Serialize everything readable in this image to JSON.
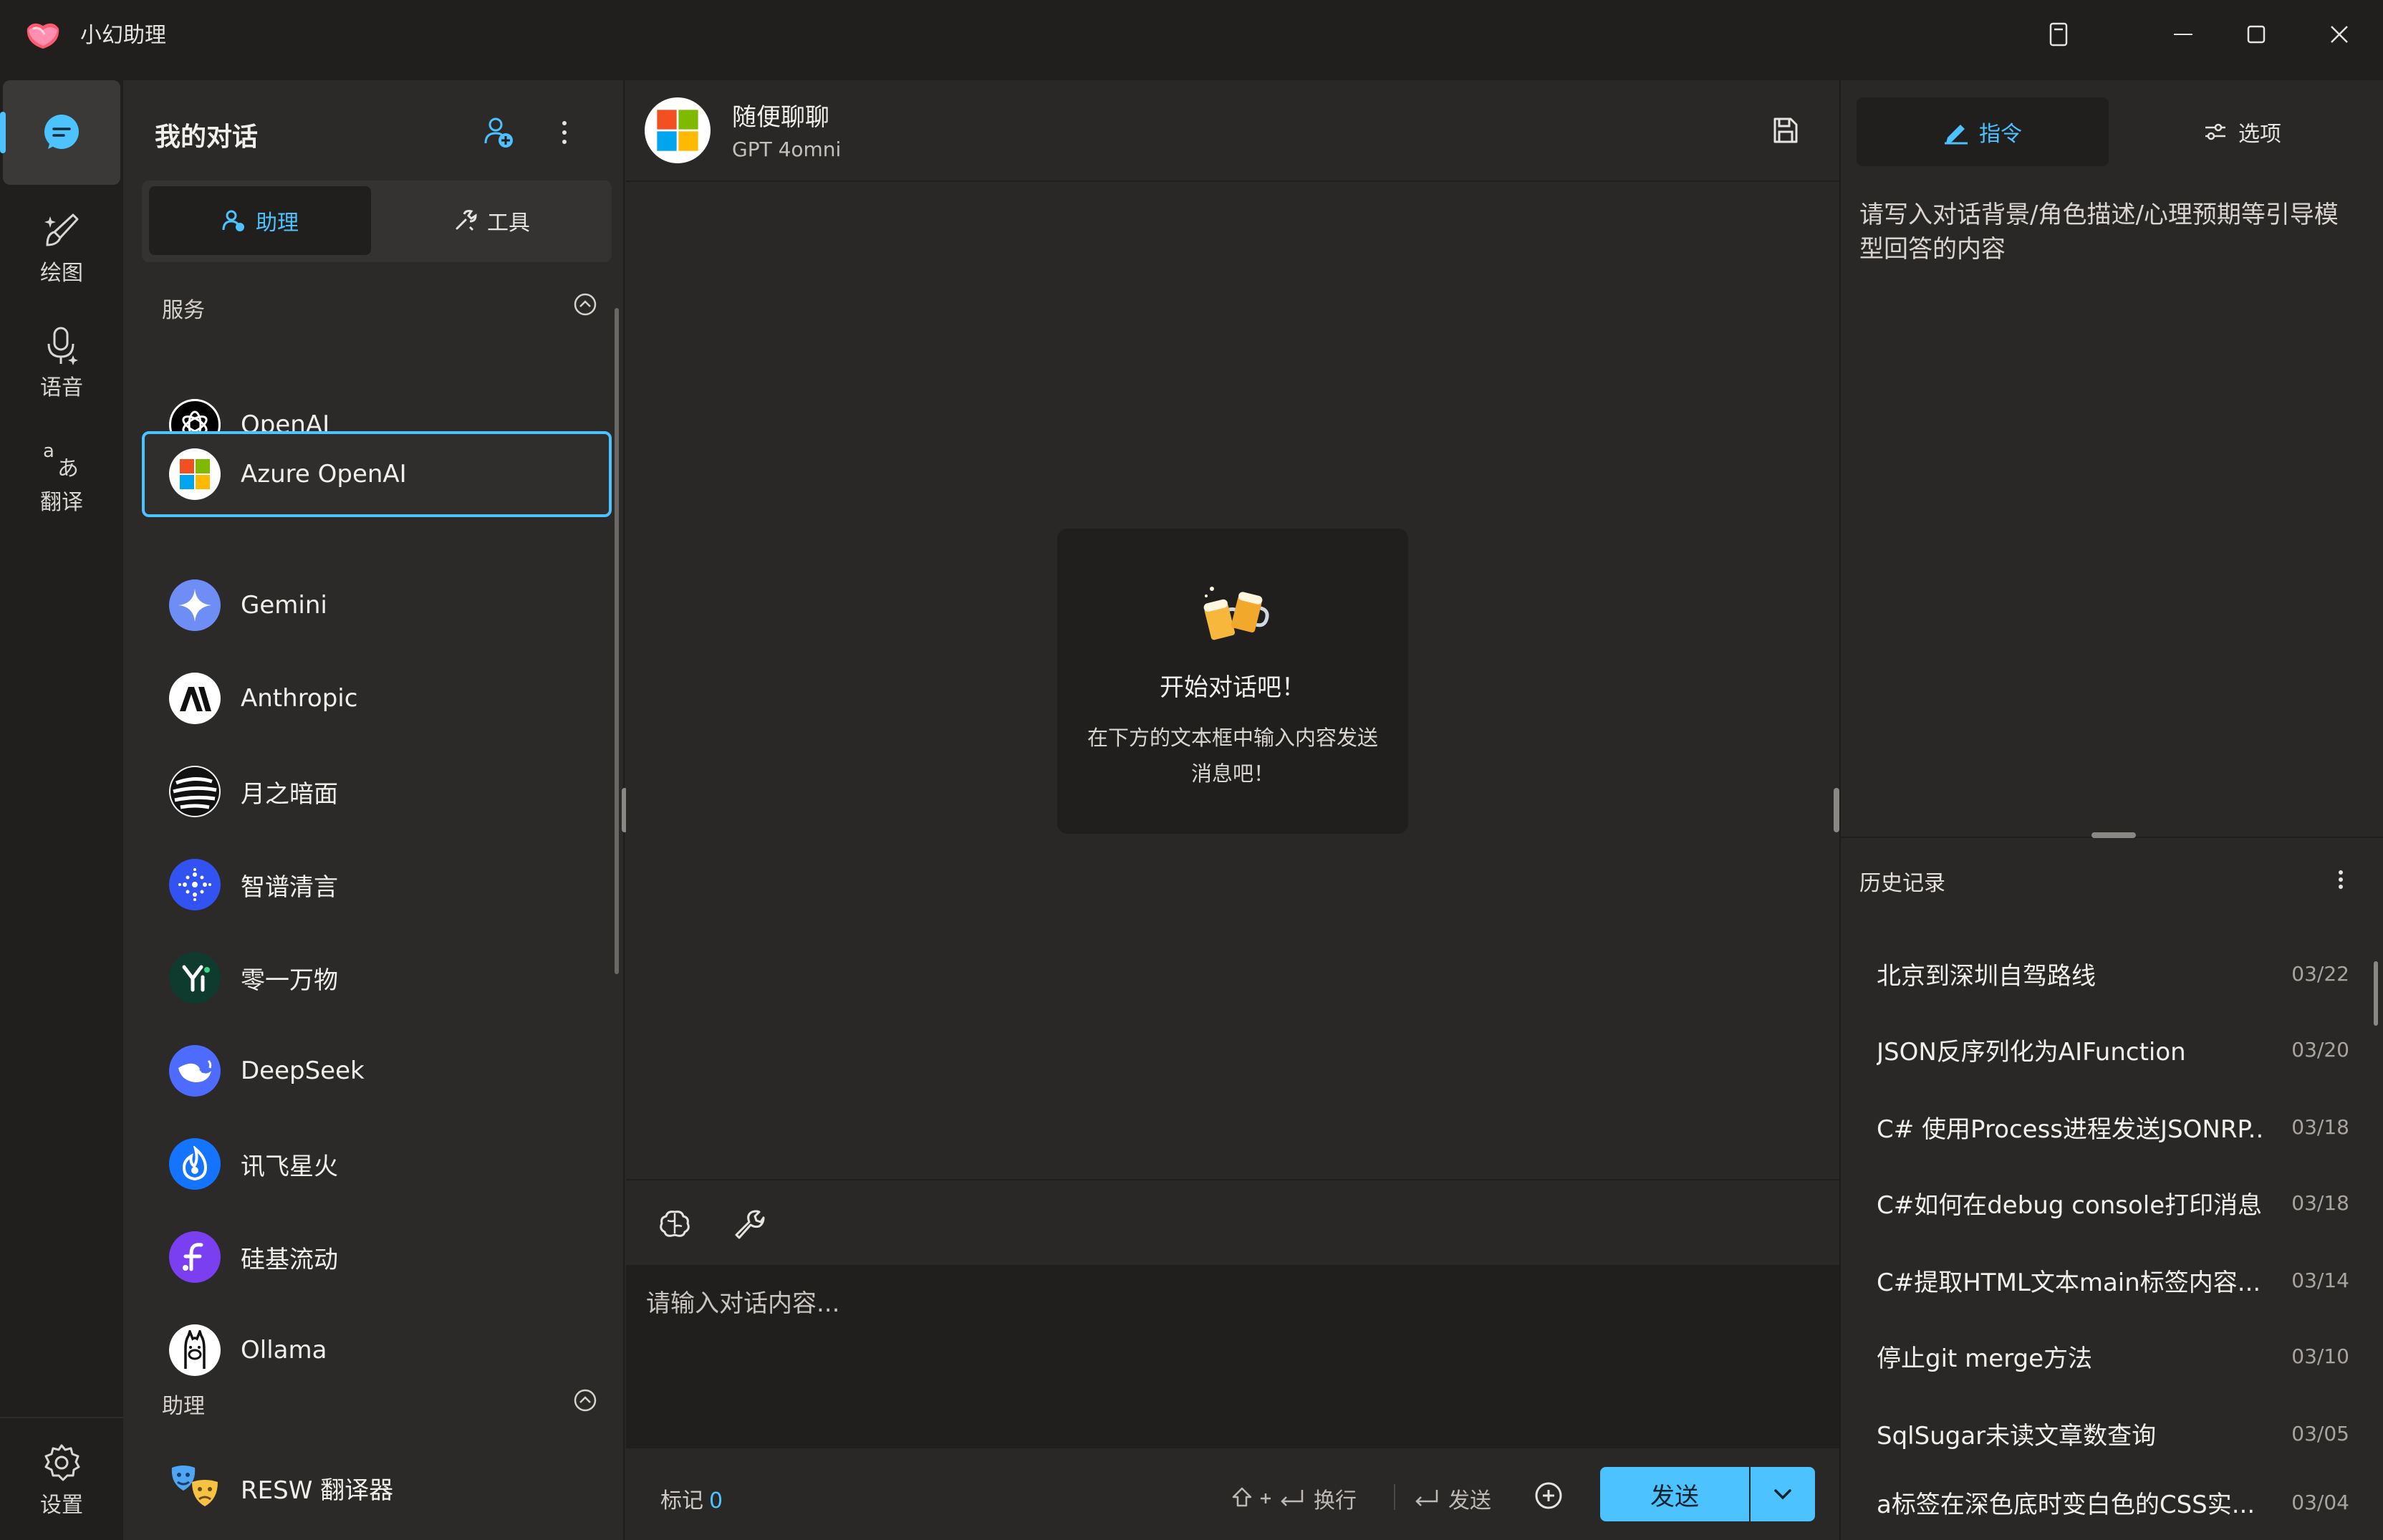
{
  "app": {
    "title": "小幻助理"
  },
  "colors": {
    "accent": "#4cc2ff",
    "background": "#2a2826",
    "sidebar": "#201f1e"
  },
  "nav": {
    "items": [
      {
        "label": "",
        "icon": "chat-bubble-icon"
      },
      {
        "label": "绘图",
        "icon": "paint-brush-icon"
      },
      {
        "label": "语音",
        "icon": "microphone-icon"
      },
      {
        "label": "翻译",
        "icon": "translate-icon"
      }
    ],
    "settings": {
      "label": "设置",
      "icon": "gear-icon"
    }
  },
  "list": {
    "title": "我的对话",
    "tabs": {
      "assist": "助理",
      "tools": "工具"
    },
    "sections": {
      "services": "服务",
      "assistants": "助理"
    },
    "services": [
      {
        "name": "OpenAI",
        "icon": "openai-logo"
      },
      {
        "name": "Azure OpenAI",
        "icon": "microsoft-logo",
        "selected": true
      },
      {
        "name": "Gemini",
        "icon": "gemini-logo"
      },
      {
        "name": "Anthropic",
        "icon": "anthropic-logo"
      },
      {
        "name": "月之暗面",
        "icon": "moonshot-logo"
      },
      {
        "name": "智谱清言",
        "icon": "zhipu-logo"
      },
      {
        "name": "零一万物",
        "icon": "yi-logo"
      },
      {
        "name": "DeepSeek",
        "icon": "deepseek-logo"
      },
      {
        "name": "讯飞星火",
        "icon": "spark-logo"
      },
      {
        "name": "硅基流动",
        "icon": "siliconflow-logo"
      },
      {
        "name": "Ollama",
        "icon": "ollama-logo"
      }
    ],
    "assistants": [
      {
        "name": "RESW 翻译器",
        "icon": "theater-masks-icon"
      }
    ]
  },
  "chat": {
    "title": "随便聊聊",
    "model": "GPT 4omni",
    "empty_title": "开始对话吧！",
    "empty_desc": "在下方的文本框中输入内容发送消息吧！",
    "input_placeholder": "请输入对话内容...",
    "mark_label": "标记",
    "mark_count": "0",
    "newline_hint": "换行",
    "send_hint": "发送",
    "send_button": "发送"
  },
  "right": {
    "tabs": {
      "instructions": "指令",
      "options": "选项"
    },
    "instructions_placeholder": "请写入对话背景/角色描述/心理预期等引导模型回答的内容",
    "history_label": "历史记录",
    "history": [
      {
        "title": "北京到深圳自驾路线",
        "date": "03/22"
      },
      {
        "title": "JSON反序列化为AIFunction",
        "date": "03/20"
      },
      {
        "title": "C# 使用Process进程发送JSONRP...",
        "date": "03/18"
      },
      {
        "title": "C#如何在debug console打印消息",
        "date": "03/18"
      },
      {
        "title": "C#提取HTML文本main标签内容...",
        "date": "03/14"
      },
      {
        "title": "停止git merge方法",
        "date": "03/10"
      },
      {
        "title": "SqlSugar未读文章数查询",
        "date": "03/05"
      },
      {
        "title": "a标签在深色底时变白色的CSS实...",
        "date": "03/04"
      }
    ]
  }
}
